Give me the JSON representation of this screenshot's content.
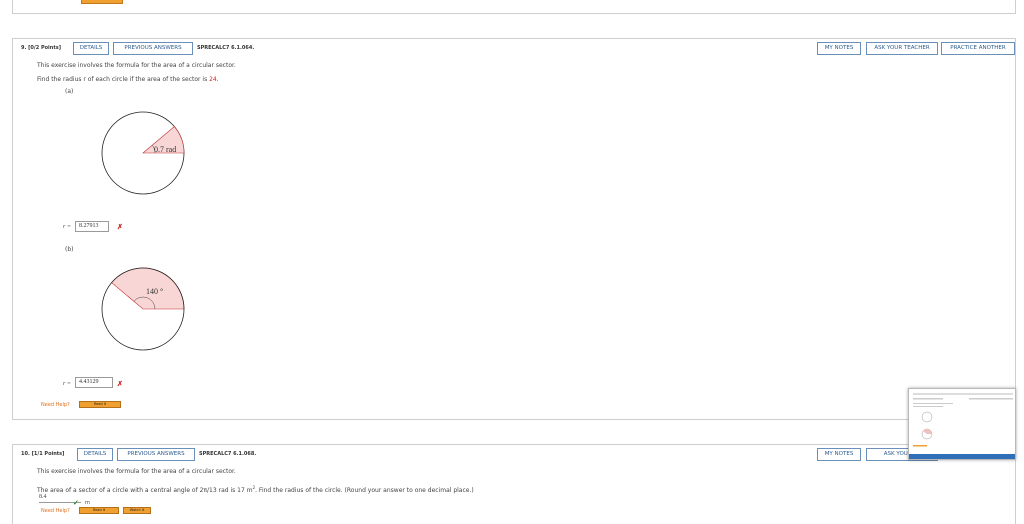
{
  "buttons": {
    "details": "DETAILS",
    "previous_answers": "PREVIOUS ANSWERS",
    "my_notes": "MY NOTES",
    "ask_teacher": "ASK YOUR TEACHER",
    "ask_teacher_truncated": "ASK YOUR TE",
    "practice_another": "PRACTICE ANOTHER"
  },
  "q9": {
    "number": "9.",
    "points": "[0/2 Points]",
    "code": "SPRECALC7 6.1.064.",
    "intro": "This exercise involves the formula for the area of a circular sector.",
    "prompt_pre": "Find the radius r of each circle if the area of the sector is ",
    "prompt_value": "24",
    "prompt_post": ".",
    "part_a": "(a)",
    "part_a_angle": "0.7 rad",
    "part_a_answer": "8.27913",
    "part_b": "(b)",
    "part_b_angle": "140 °",
    "part_b_answer": "4.43129",
    "r_label": "r =",
    "need_help": "Need Help?",
    "read_it": "Read It"
  },
  "q10": {
    "number": "10.",
    "points": "[1/1 Points]",
    "code": "SPRECALC7 6.1.068.",
    "intro": "This exercise involves the formula for the area of a circular sector.",
    "prompt_pre": "The area of a sector of a circle with a central angle of 2π/13 rad is 17 m",
    "prompt_sup": "2",
    "prompt_post": ". Find the radius of the circle. (Round your answer to one decimal place.)",
    "answer": "8.4",
    "unit": "m",
    "need_help": "Need Help?",
    "read_it": "Read It",
    "watch_it": "Watch It"
  },
  "colors": {
    "button_border": "#6a8fb8",
    "error": "#cc2222",
    "sector_fill": "#f9d6d6",
    "help_orange": "#f0a030",
    "correct": "#2a8a2a"
  }
}
